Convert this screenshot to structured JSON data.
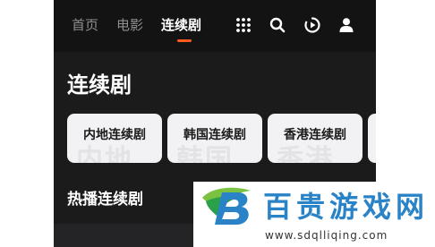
{
  "nav": {
    "tabs": [
      {
        "label": "首页",
        "active": false
      },
      {
        "label": "电影",
        "active": false
      },
      {
        "label": "连续剧",
        "active": true
      }
    ],
    "accent_color": "#ff5a1f",
    "icons": [
      "grid-icon",
      "search-icon",
      "play-history-icon",
      "user-icon"
    ]
  },
  "section": {
    "title": "连续剧",
    "categories": [
      {
        "label": "内地连续剧",
        "watermark": "内地"
      },
      {
        "label": "韩国连续剧",
        "watermark": "韩国"
      },
      {
        "label": "香港连续剧",
        "watermark": "香港"
      },
      {
        "label": "",
        "watermark": ""
      }
    ]
  },
  "hot": {
    "title": "热播连续剧"
  },
  "watermark_brand": {
    "name": "百贵游戏网",
    "url": "www.sdqlliqing.com",
    "color": "#2a83c6"
  }
}
